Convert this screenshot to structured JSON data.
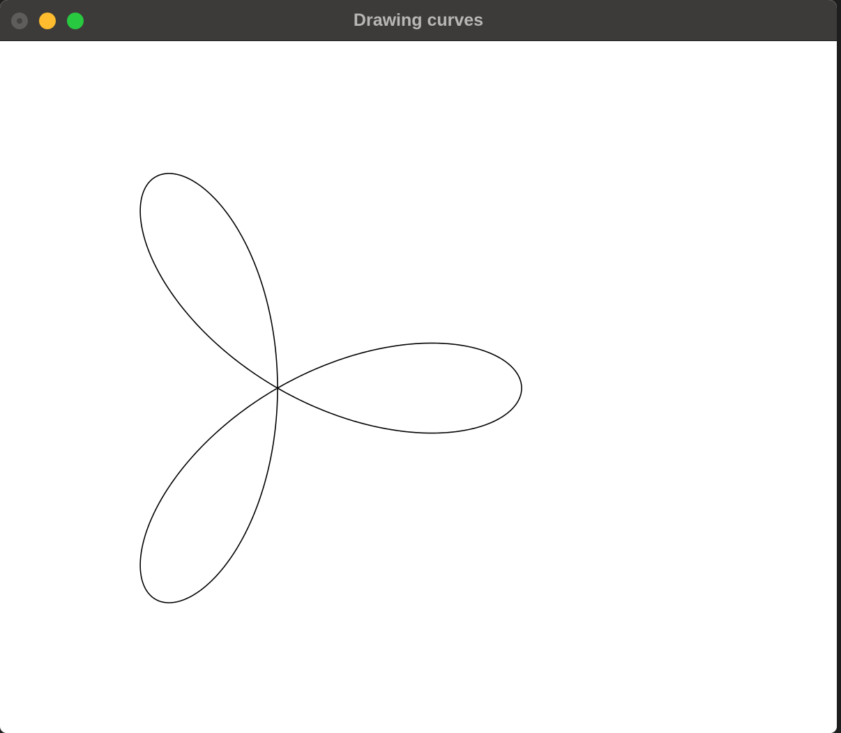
{
  "window": {
    "title": "Drawing curves"
  },
  "controls": {
    "close_icon": "close-icon",
    "minimize_icon": "minimize-icon",
    "zoom_icon": "zoom-icon"
  },
  "colors": {
    "titlebar": "#3d3b39",
    "close": "#5f5d5b",
    "minimize": "#febc2e",
    "zoom": "#28c840",
    "curve": "#000000",
    "canvas": "#ffffff"
  },
  "curve": {
    "type": "three-petal rose",
    "petals": 3
  }
}
